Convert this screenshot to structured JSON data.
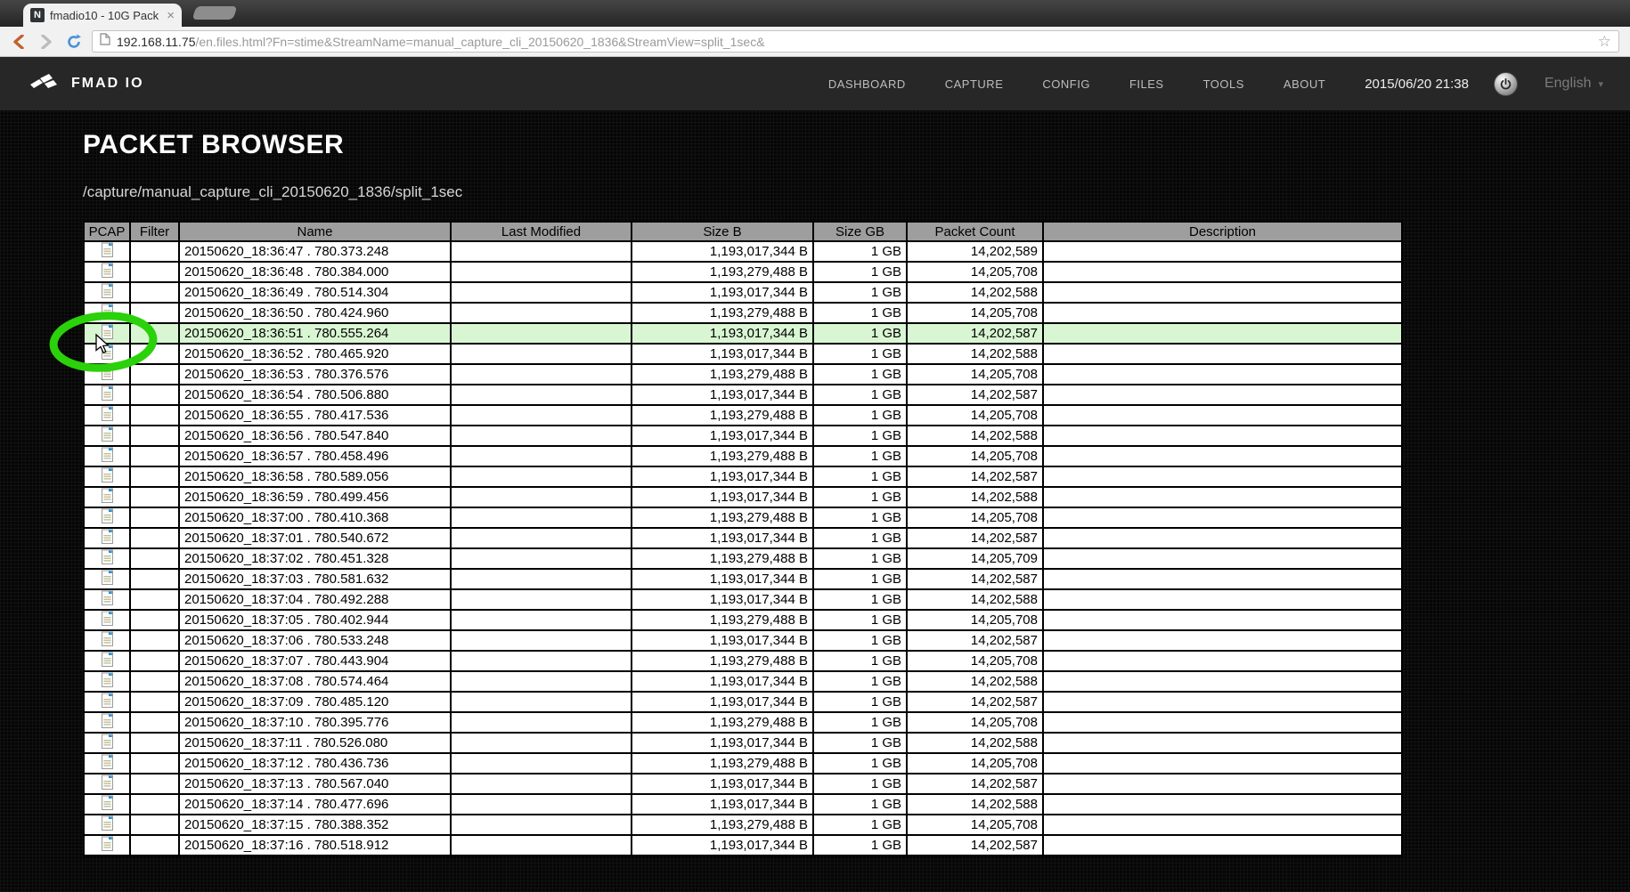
{
  "colors": {
    "annotation_green": "#2bd10a",
    "row_highlight": "#d9f6d3",
    "table_header_bg": "#9e9e9e",
    "navbar_bg": "#272727",
    "reload_blue": "#4a90d9",
    "back_orange": "#c0622f"
  },
  "browser": {
    "tab": {
      "favicon_letter": "N",
      "title": "fmadio10 - 10G Pack",
      "close_label": "×"
    },
    "toolbar": {
      "url_host": "192.168.11.75",
      "url_rest": "/en.files.html?Fn=stime&StreamName=manual_capture_cli_20150620_1836&StreamView=split_1sec&",
      "bookmark_star": "☆"
    }
  },
  "navbar": {
    "brand": "FMAD IO",
    "links": [
      "DASHBOARD",
      "CAPTURE",
      "CONFIG",
      "FILES",
      "TOOLS",
      "ABOUT"
    ],
    "timestamp": "2015/06/20 21:38",
    "language": "English",
    "language_caret": "▾"
  },
  "page": {
    "title": "PACKET BROWSER",
    "path": "/capture/manual_capture_cli_20150620_1836/split_1sec"
  },
  "table": {
    "headers": [
      "PCAP",
      "Filter",
      "Name",
      "Last Modified",
      "Size B",
      "Size GB",
      "Packet Count",
      "Description"
    ],
    "highlighted_row_index": 4,
    "rows": [
      {
        "name": "20150620_18:36:47 . 780.373.248",
        "size_b": "1,193,017,344 B",
        "size_gb": "1 GB",
        "packets": "14,202,589"
      },
      {
        "name": "20150620_18:36:48 . 780.384.000",
        "size_b": "1,193,279,488 B",
        "size_gb": "1 GB",
        "packets": "14,205,708"
      },
      {
        "name": "20150620_18:36:49 . 780.514.304",
        "size_b": "1,193,017,344 B",
        "size_gb": "1 GB",
        "packets": "14,202,588"
      },
      {
        "name": "20150620_18:36:50 . 780.424.960",
        "size_b": "1,193,279,488 B",
        "size_gb": "1 GB",
        "packets": "14,205,708"
      },
      {
        "name": "20150620_18:36:51 . 780.555.264",
        "size_b": "1,193,017,344 B",
        "size_gb": "1 GB",
        "packets": "14,202,587"
      },
      {
        "name": "20150620_18:36:52 . 780.465.920",
        "size_b": "1,193,017,344 B",
        "size_gb": "1 GB",
        "packets": "14,202,588"
      },
      {
        "name": "20150620_18:36:53 . 780.376.576",
        "size_b": "1,193,279,488 B",
        "size_gb": "1 GB",
        "packets": "14,205,708"
      },
      {
        "name": "20150620_18:36:54 . 780.506.880",
        "size_b": "1,193,017,344 B",
        "size_gb": "1 GB",
        "packets": "14,202,587"
      },
      {
        "name": "20150620_18:36:55 . 780.417.536",
        "size_b": "1,193,279,488 B",
        "size_gb": "1 GB",
        "packets": "14,205,708"
      },
      {
        "name": "20150620_18:36:56 . 780.547.840",
        "size_b": "1,193,017,344 B",
        "size_gb": "1 GB",
        "packets": "14,202,588"
      },
      {
        "name": "20150620_18:36:57 . 780.458.496",
        "size_b": "1,193,279,488 B",
        "size_gb": "1 GB",
        "packets": "14,205,708"
      },
      {
        "name": "20150620_18:36:58 . 780.589.056",
        "size_b": "1,193,017,344 B",
        "size_gb": "1 GB",
        "packets": "14,202,587"
      },
      {
        "name": "20150620_18:36:59 . 780.499.456",
        "size_b": "1,193,017,344 B",
        "size_gb": "1 GB",
        "packets": "14,202,588"
      },
      {
        "name": "20150620_18:37:00 . 780.410.368",
        "size_b": "1,193,279,488 B",
        "size_gb": "1 GB",
        "packets": "14,205,708"
      },
      {
        "name": "20150620_18:37:01 . 780.540.672",
        "size_b": "1,193,017,344 B",
        "size_gb": "1 GB",
        "packets": "14,202,587"
      },
      {
        "name": "20150620_18:37:02 . 780.451.328",
        "size_b": "1,193,279,488 B",
        "size_gb": "1 GB",
        "packets": "14,205,709"
      },
      {
        "name": "20150620_18:37:03 . 780.581.632",
        "size_b": "1,193,017,344 B",
        "size_gb": "1 GB",
        "packets": "14,202,587"
      },
      {
        "name": "20150620_18:37:04 . 780.492.288",
        "size_b": "1,193,017,344 B",
        "size_gb": "1 GB",
        "packets": "14,202,588"
      },
      {
        "name": "20150620_18:37:05 . 780.402.944",
        "size_b": "1,193,279,488 B",
        "size_gb": "1 GB",
        "packets": "14,205,708"
      },
      {
        "name": "20150620_18:37:06 . 780.533.248",
        "size_b": "1,193,017,344 B",
        "size_gb": "1 GB",
        "packets": "14,202,587"
      },
      {
        "name": "20150620_18:37:07 . 780.443.904",
        "size_b": "1,193,279,488 B",
        "size_gb": "1 GB",
        "packets": "14,205,708"
      },
      {
        "name": "20150620_18:37:08 . 780.574.464",
        "size_b": "1,193,017,344 B",
        "size_gb": "1 GB",
        "packets": "14,202,588"
      },
      {
        "name": "20150620_18:37:09 . 780.485.120",
        "size_b": "1,193,017,344 B",
        "size_gb": "1 GB",
        "packets": "14,202,587"
      },
      {
        "name": "20150620_18:37:10 . 780.395.776",
        "size_b": "1,193,279,488 B",
        "size_gb": "1 GB",
        "packets": "14,205,708"
      },
      {
        "name": "20150620_18:37:11 . 780.526.080",
        "size_b": "1,193,017,344 B",
        "size_gb": "1 GB",
        "packets": "14,202,588"
      },
      {
        "name": "20150620_18:37:12 . 780.436.736",
        "size_b": "1,193,279,488 B",
        "size_gb": "1 GB",
        "packets": "14,205,708"
      },
      {
        "name": "20150620_18:37:13 . 780.567.040",
        "size_b": "1,193,017,344 B",
        "size_gb": "1 GB",
        "packets": "14,202,587"
      },
      {
        "name": "20150620_18:37:14 . 780.477.696",
        "size_b": "1,193,017,344 B",
        "size_gb": "1 GB",
        "packets": "14,202,588"
      },
      {
        "name": "20150620_18:37:15 . 780.388.352",
        "size_b": "1,193,279,488 B",
        "size_gb": "1 GB",
        "packets": "14,205,708"
      },
      {
        "name": "20150620_18:37:16 . 780.518.912",
        "size_b": "1,193,017,344 B",
        "size_gb": "1 GB",
        "packets": "14,202,587"
      }
    ]
  }
}
